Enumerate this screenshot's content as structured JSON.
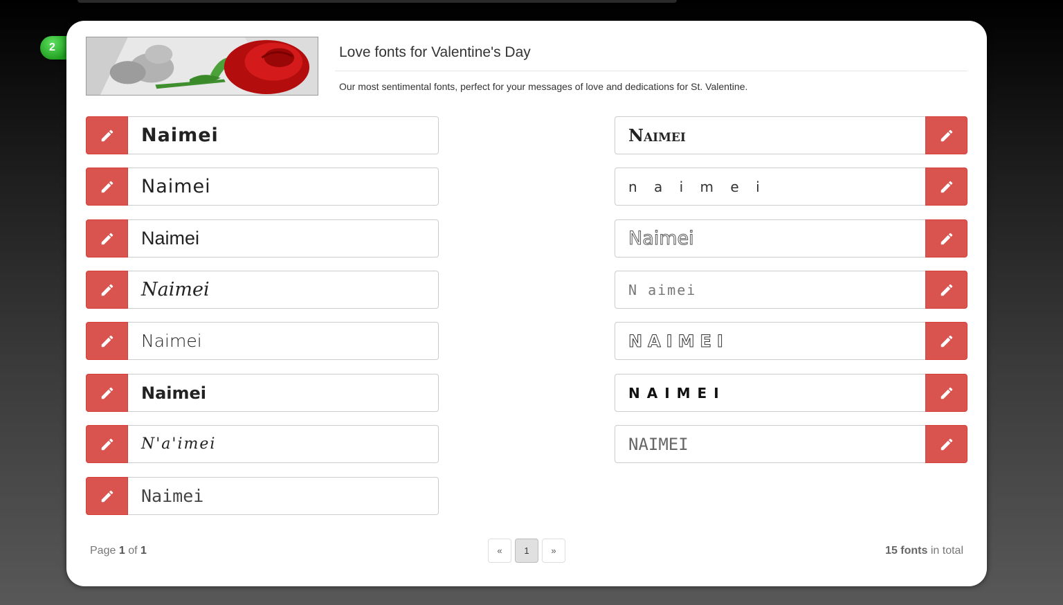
{
  "step_number": "2",
  "header": {
    "title": "Love fonts for Valentine's Day",
    "description": "Our most sentimental fonts, perfect for your messages of love and dedications for St. Valentine."
  },
  "preview_text": "Naimei",
  "left_fonts": [
    {
      "text": "Naimei"
    },
    {
      "text": "Naimei"
    },
    {
      "text": "Naimei"
    },
    {
      "text": "Naimei"
    },
    {
      "text": "Naimei"
    },
    {
      "text": "Naimei"
    },
    {
      "text": "N'a'imei"
    },
    {
      "text": "Naimei"
    }
  ],
  "right_fonts": [
    {
      "text": "Naimei"
    },
    {
      "text": "n a i m e i"
    },
    {
      "text": "Naimei"
    },
    {
      "text": "N aimei"
    },
    {
      "text": "NAIMEI"
    },
    {
      "text": "NAIMEI"
    },
    {
      "text": "NAIMEI"
    }
  ],
  "pagination": {
    "page_label": "Page",
    "current": "1",
    "of_label": "of",
    "total_pages": "1",
    "prev": "«",
    "page_button": "1",
    "next": "»"
  },
  "total": {
    "count_label": "15 fonts",
    "suffix": "in total"
  },
  "icons": {
    "edit": "pencil-icon"
  },
  "colors": {
    "edit_button": "#d9534f",
    "badge": "#2fb52f"
  }
}
